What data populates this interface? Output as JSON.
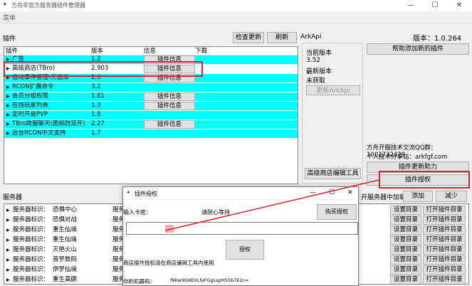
{
  "window": {
    "title": "方舟非官方服务器插件管理器"
  },
  "menu": {
    "label": "菜单"
  },
  "plugins": {
    "section_label": "插件",
    "check_update": "检查更新",
    "refresh": "刷新",
    "columns": [
      "插件",
      "版本",
      "信息",
      "下载"
    ],
    "info_button": "插件信息",
    "rows": [
      {
        "name": "广告",
        "version": "1.2",
        "has_info": true,
        "highlight": true
      },
      {
        "name": "高级商店(TBro)",
        "version": "2.903",
        "has_info": true,
        "highlight": false
      },
      {
        "name": "自动事件管理-天选派",
        "version": "2.6",
        "has_info": true,
        "highlight": true
      },
      {
        "name": "RCON扩展命令",
        "version": "3.2",
        "has_info": false,
        "highlight": true
      },
      {
        "name": "会员分组权限",
        "version": "1.81",
        "has_info": true,
        "highlight": true
      },
      {
        "name": "在线玩家列表",
        "version": "1.3",
        "has_info": true,
        "highlight": true
      },
      {
        "name": "定时开启PVP",
        "version": "1.8",
        "has_info": false,
        "highlight": true
      },
      {
        "name": "TBro跨服聊天(图标防双开)",
        "version": "2.27",
        "has_info": true,
        "highlight": true
      },
      {
        "name": "后台RCON中文支持",
        "version": "1.7",
        "has_info": false,
        "highlight": true
      }
    ]
  },
  "arkapi": {
    "label": "ArkApi",
    "current_version_label": "当前版本",
    "current_version": "3.52",
    "latest_version_label": "最新版本",
    "latest_version": "未获取",
    "update_button": "更新ArkApi",
    "shop_editor_button": "高级商店编辑工具"
  },
  "right": {
    "version": "版本：1.0.264",
    "help_add_button": "帮助添加新的插件",
    "qq_group": "方舟开服技术交流QQ群：1002732429",
    "share_site": "个人技术分享站：arkfgf.com",
    "update_help_button": "插件更新助力",
    "auth_button": "插件授权"
  },
  "servers": {
    "section_label": "服务器",
    "load_label": "开服务器中加载",
    "add_button": "添加",
    "reduce_button": "减少",
    "set_dir_button": "设置目录",
    "open_plugin_dir_button": "打开插件目录",
    "id_label": "服务器标识：",
    "col_label": "服务",
    "rows": [
      "恐惧中心",
      "恐惧对战",
      "重生仙境",
      "重生仙境",
      "灭绝火山",
      "普罗数码",
      "伊罗仙境",
      "重生高朗"
    ]
  },
  "dialog": {
    "title": "插件授权",
    "input_label": "输入卡密：",
    "hint": "请耐心等待",
    "buy_button": "购买授权",
    "auth_button": "授权",
    "note": "商店插件授权请在商店编辑工具内使用",
    "machine_label": "你的机器码：",
    "machine_code": "f6Kw9G6EXLfeFGgLspH55b7E2c="
  }
}
